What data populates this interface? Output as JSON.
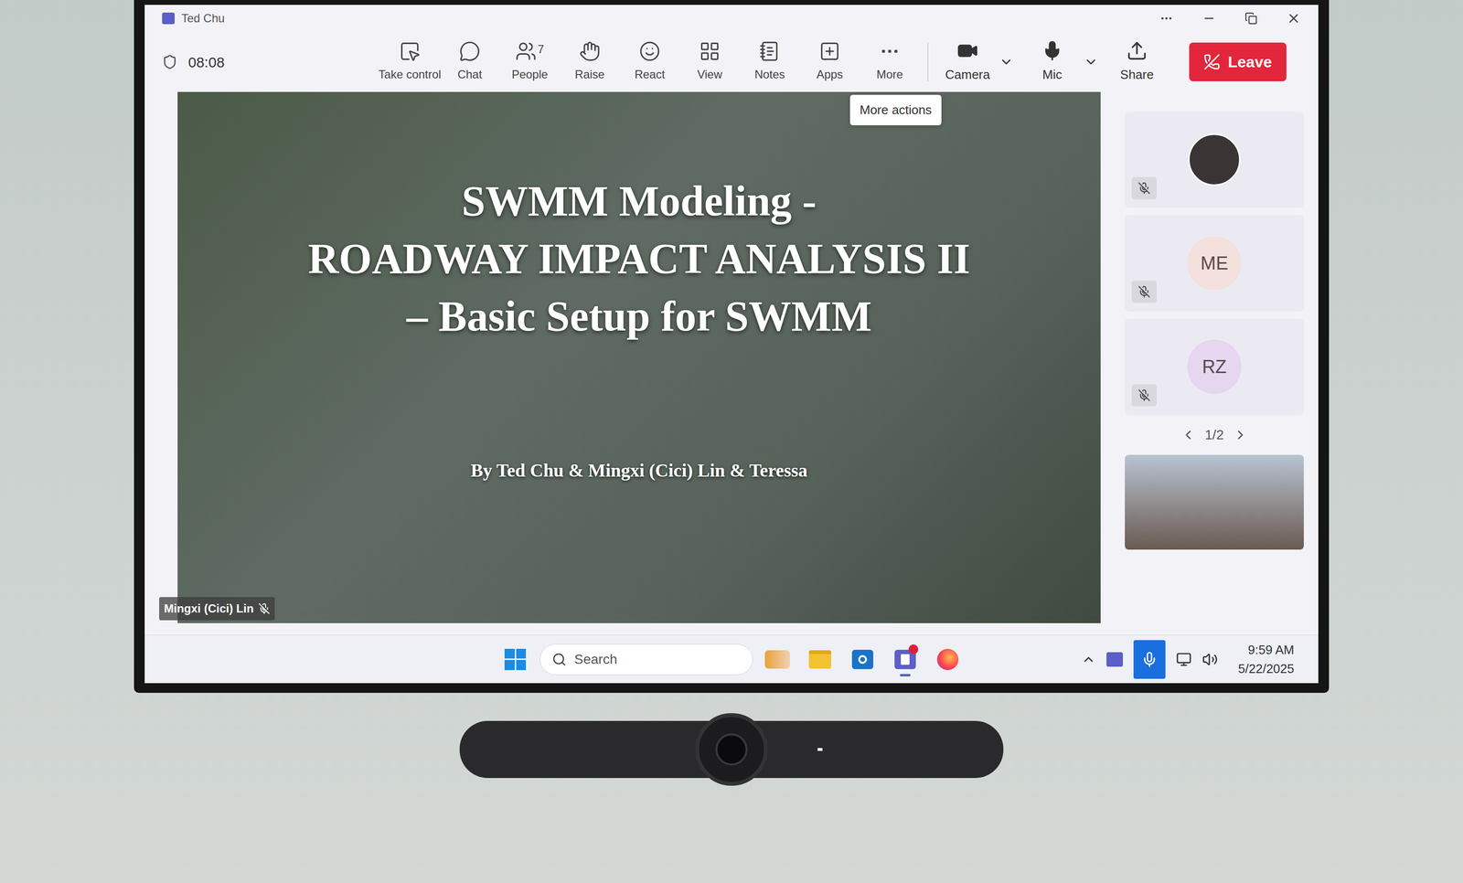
{
  "window": {
    "title": "Ted Chu"
  },
  "meeting": {
    "timer": "08:08"
  },
  "actions": [
    {
      "label": "Take control",
      "badge": ""
    },
    {
      "label": "Chat",
      "badge": ""
    },
    {
      "label": "People",
      "badge": "7"
    },
    {
      "label": "Raise",
      "badge": ""
    },
    {
      "label": "React",
      "badge": ""
    },
    {
      "label": "View",
      "badge": ""
    },
    {
      "label": "Notes",
      "badge": ""
    },
    {
      "label": "Apps",
      "badge": ""
    },
    {
      "label": "More",
      "badge": ""
    }
  ],
  "devices": [
    {
      "label": "Camera",
      "on": true
    },
    {
      "label": "Mic",
      "on": true
    }
  ],
  "share": "Share",
  "leave": "Leave",
  "tooltip": "More actions",
  "slide": {
    "lines": [
      "SWMM Modeling -",
      "ROADWAY IMPACT ANALYSIS II",
      "– Basic Setup for SWMM"
    ],
    "byline": "By Ted Chu & Mingxi (Cici) Lin & Teressa"
  },
  "presenter": {
    "name": "Mingxi (Cici) Lin",
    "muted": true
  },
  "participants": [
    {
      "kind": "photo",
      "initials": "",
      "muted": true,
      "color": "#3a3434"
    },
    {
      "kind": "initials",
      "initials": "ME",
      "muted": true,
      "color": "#f4e0dc"
    },
    {
      "kind": "initials",
      "initials": "RZ",
      "muted": true,
      "color": "#e6d6f0"
    }
  ],
  "pager": "1/2",
  "taskbar": {
    "search": "Search",
    "time": "9:59 AM",
    "date": "5/22/2025",
    "mic_active": true,
    "apps": [
      {
        "kind": "widgets",
        "badge": false,
        "active": false
      },
      {
        "kind": "explorer",
        "badge": false,
        "active": false
      },
      {
        "kind": "outlook",
        "badge": false,
        "active": false
      },
      {
        "kind": "teams",
        "badge": true,
        "active": true
      },
      {
        "kind": "firefox",
        "badge": false,
        "active": false
      }
    ]
  }
}
